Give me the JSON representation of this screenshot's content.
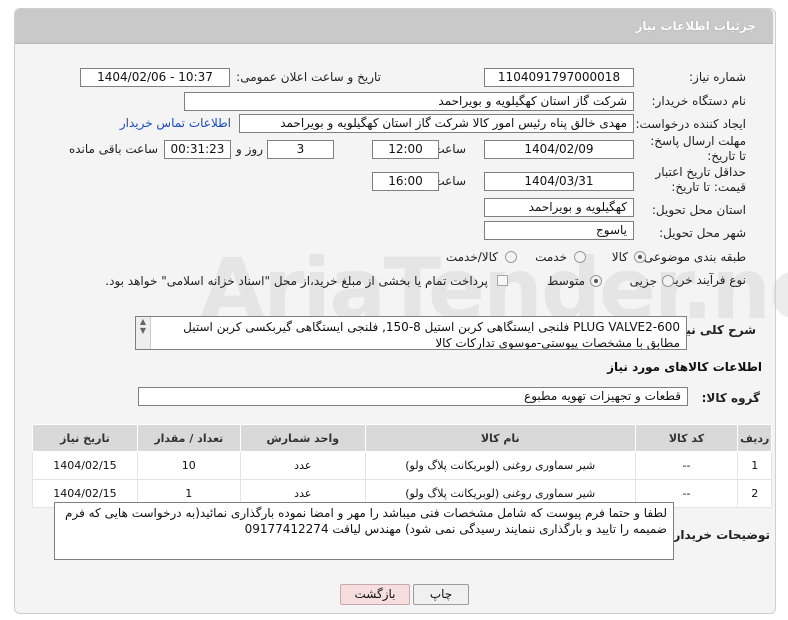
{
  "header": {
    "title": "جزئیات اطلاعات نیاز"
  },
  "fields": {
    "need_number": {
      "label": "شماره نیاز:",
      "value": "1104091797000018"
    },
    "announce_datetime": {
      "label": "تاریخ و ساعت اعلان عمومی:",
      "value": "1404/02/06 - 10:37"
    },
    "buyer_org": {
      "label": "نام دستگاه خریدار:",
      "value": "شرکت گاز استان کهگیلویه و بویراحمد"
    },
    "requester": {
      "label": "ایجاد کننده درخواست:",
      "value": "مهدی خالق پناه رئیس امور کالا شرکت گاز استان کهگیلویه و بویراحمد",
      "contact_link": "اطلاعات تماس خریدار"
    },
    "deadline": {
      "label": "مهلت ارسال پاسخ: تا تاریخ:",
      "date": "1404/02/09",
      "time_label": "ساعت",
      "time": "12:00",
      "days": "3",
      "days_label": "روز و",
      "remaining": "00:31:23",
      "remaining_label": "ساعت باقی مانده"
    },
    "price_validity": {
      "label": "حداقل تاریخ اعتبار قیمت: تا تاریخ:",
      "date": "1404/03/31",
      "time_label": "ساعت",
      "time": "16:00"
    },
    "delivery_province": {
      "label": "استان محل تحویل:",
      "value": "کهگیلویه و بویراحمد"
    },
    "delivery_city": {
      "label": "شهر محل تحویل:",
      "value": "یاسوج"
    },
    "category": {
      "label": "طبقه بندی موضوعی:",
      "options": [
        "کالا",
        "خدمت",
        "کالا/خدمت"
      ],
      "selected": "کالا"
    },
    "purchase_type": {
      "label": "نوع فرآیند خرید :",
      "options": [
        "جزیی",
        "متوسط"
      ],
      "selected": "متوسط",
      "payment_note": "پرداخت تمام یا بخشی از مبلغ خرید،از محل \"اسناد خزانه اسلامی\" خواهد بود."
    },
    "description": {
      "label": "شرح کلی نیاز:",
      "line1": "PLUG VALVE2-600 فلنجی ایستگاهی کربن استیل 8-150, فلنجی ایستگاهی گیربکسی کربن استیل",
      "line2": "مطابق با مشخصات پیوستی-موسوی تدارکات کالا"
    }
  },
  "items_section": {
    "title": "اطلاعات کالاهای مورد نیاز",
    "group_label": "گروه کالا:",
    "group_value": "قطعات و تجهیزات تهویه مطبوع",
    "columns": [
      "ردیف",
      "کد کالا",
      "نام کالا",
      "واحد شمارش",
      "تعداد / مقدار",
      "تاریخ نیاز"
    ],
    "rows": [
      [
        "1",
        "--",
        "شیر سماوری روغنی (لوبریکانت پلاگ ولو)",
        "عدد",
        "10",
        "1404/02/15"
      ],
      [
        "2",
        "--",
        "شیر سماوری روغنی (لوبریکانت پلاگ ولو)",
        "عدد",
        "1",
        "1404/02/15"
      ]
    ]
  },
  "buyer_notes": {
    "label": "توضیحات خریدار:",
    "text": "لطفا و حتما فرم پیوست که شامل مشخصات فنی میباشد را مهر و امضا نموده بارگذاری نمائید(به درخواست هایی که فرم ضمیمه را تایید و بارگذاری ننمایند رسیدگی نمی شود) مهندس لیاقت 09177412274"
  },
  "buttons": {
    "print": "چاپ",
    "back": "بازگشت"
  },
  "watermark": "AriaTender.neT"
}
